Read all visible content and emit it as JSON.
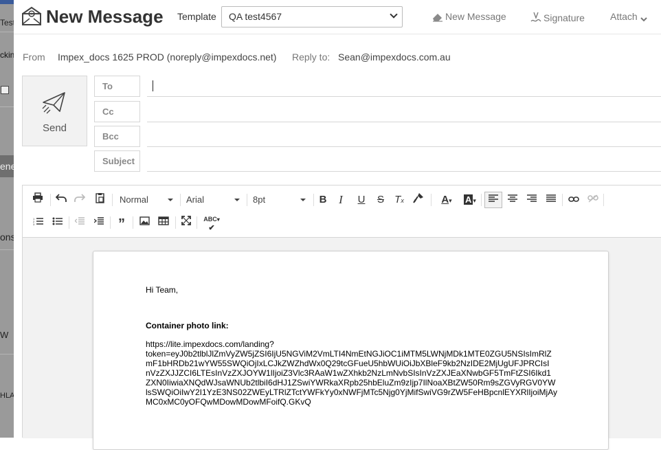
{
  "background": {
    "fragments": [
      "Test",
      "ckin",
      "ene",
      "ons",
      "W",
      "HLA"
    ]
  },
  "header": {
    "title": "New Message",
    "template_label": "Template",
    "template_value": "QA test4567",
    "new_message_label": "New Message",
    "signature_label": "Signature",
    "attach_label": "Attach"
  },
  "meta": {
    "from_label": "From",
    "from_value": "Impex_docs 1625 PROD (noreply@impexdocs.net)",
    "reply_to_label": "Reply to:",
    "reply_to_value": "Sean@impexdocs.com.au"
  },
  "send": {
    "label": "Send"
  },
  "fields": {
    "to_label": "To",
    "cc_label": "Cc",
    "bcc_label": "Bcc",
    "subject_label": "Subject",
    "to_value": "",
    "cc_value": "",
    "bcc_value": "",
    "subject_value": ""
  },
  "toolbar": {
    "style_value": "Normal",
    "font_value": "Arial",
    "size_value": "8pt"
  },
  "message": {
    "greeting": "Hi Team,",
    "heading": "Container photo link:",
    "link_lines": [
      "https://lite.impexdocs.com/landing?",
      "token=eyJ0b2tlblJlZmVyZW5jZSI6IjU5NGViM2VmLTI4NmEtNGJiOC1iMTM5LWNjMDk1MTE0ZGU5NSIsImRlZ",
      "mF1bHRDb21wYW55SWQiOjIxLCJkZWZhdWx0Q29tcGFueU5hbWUiOiJbXBleF9kb2NzIDE2MjUgUFJPRCIsI",
      "nVzZXJJZCI6LTEsInVzZXJOYW1lIjoiZ3Vlc3RAaW1wZXhkb2NzLmNvbSIsInVzZXJEaXNwbGF5TmFtZSI6Ikd1",
      "ZXN0IiwiaXNQdWJsaWNUb2tlbiI6dHJ1ZSwiYWRkaXRpb25hbEluZm9zIjp7IlNoaXBtZW50Rm9sZGVyRGV0YW",
      "lsSWQiOiIwY2I1YzE3NS02ZWEyLTRlZTctYWFkYy0xNWFjMTc5Njg0YjMifSwiVG9rZW5FeHBpcnlEYXRlIjoiMjAy",
      "MC0xMC0yOFQwMDowMDowMFoifQ.GKvQ"
    ]
  },
  "colors": {
    "accent_text": "#333333",
    "muted": "#777777",
    "border": "#d6d6d6",
    "send_bg": "#f2f2f2"
  }
}
